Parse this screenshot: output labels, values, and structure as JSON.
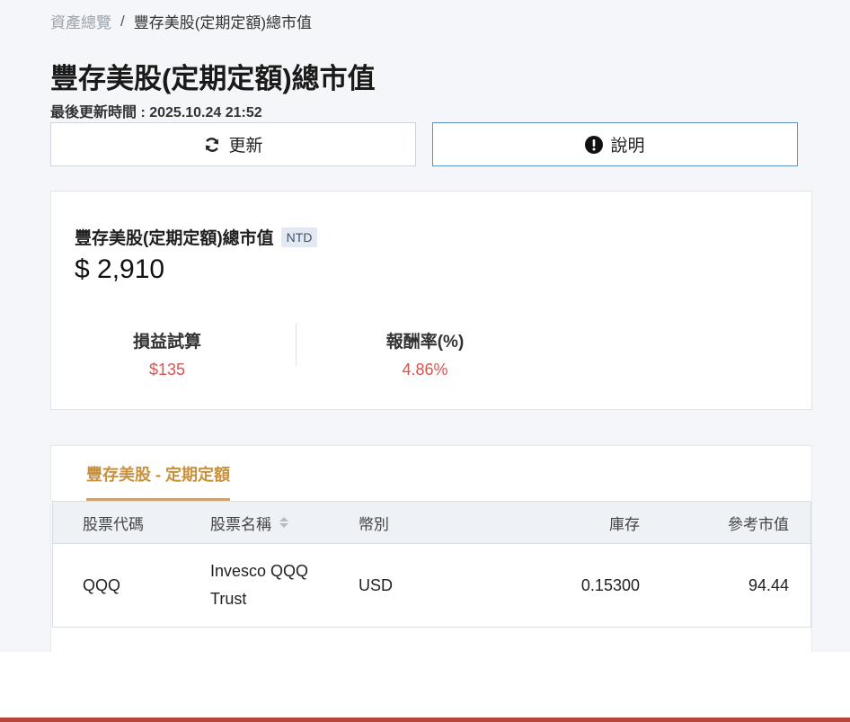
{
  "breadcrumb": {
    "home": "資產總覽",
    "separator": "/",
    "current": "豐存美股(定期定額)總市值"
  },
  "page": {
    "title": "豐存美股(定期定額)總市值",
    "updated": "最後更新時間 : 2025.10.24 21:52"
  },
  "actions": {
    "refresh_label": "更新",
    "help_label": "說明"
  },
  "summary": {
    "title": "豐存美股(定期定額)總市值",
    "currency_badge": "NTD",
    "total": "$ 2,910",
    "profit_label": "損益試算",
    "profit_value": "$135",
    "return_label": "報酬率(%)",
    "return_value": "4.86%"
  },
  "holdings": {
    "tab_label": "豐存美股 - 定期定額",
    "columns": [
      "股票代碼",
      "股票名稱",
      "幣別",
      "庫存",
      "參考市值"
    ],
    "rows": [
      {
        "code": "QQQ",
        "name": "Invesco QQQ Trust",
        "currency": "USD",
        "quantity": "0.15300",
        "value": "94.44"
      }
    ]
  },
  "colors": {
    "accent_gold": "#c7913d",
    "negative_red": "#d9534f",
    "help_border": "#5b93c8",
    "bottom_bar": "#b5463b"
  }
}
